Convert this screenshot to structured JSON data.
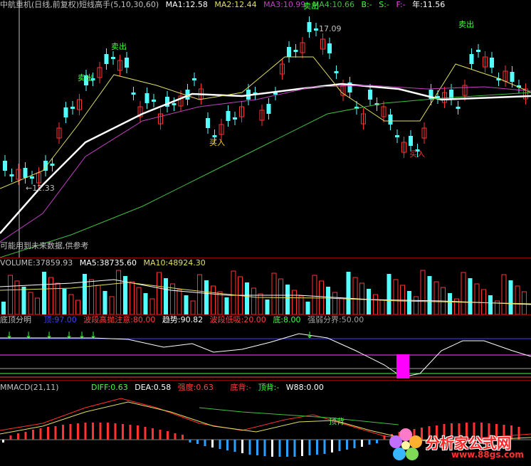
{
  "main": {
    "title": "中航重机(日线,前复权)",
    "indicator": "短线高手(5,10,30,60)",
    "ma1": "MA1:12.58",
    "ma2": "MA2:12.44",
    "ma3": "MA3:10.99",
    "ma4": "MA4:10.66",
    "b": "B:-",
    "s": "S:-",
    "f": "F:-",
    "nian": "年:11.56",
    "high_label": "17.09",
    "low_label": "12.33",
    "sell_label": "卖出",
    "buy_label": "买入",
    "disclaimer": "可能用到未来数据,供参考",
    "colors": {
      "up": "#ff3232",
      "down": "#54ffff",
      "ma_white": "#ffffff",
      "ma_yellow": "#e0e060",
      "ma_purple": "#c040c0",
      "ma_green": "#40c040"
    }
  },
  "volume": {
    "volume": "VOLUME:37859.93",
    "ma5": "MA5:38735.60",
    "ma10": "MA10:48924.30"
  },
  "dingdi": {
    "name": "底顶分明",
    "ding": "顶:97.00",
    "high_warn": "波段高抛注意:80.00",
    "trend": "趋势:90.82",
    "low_buy": "波段低吸:20.00",
    "di": "底:8.00",
    "boundary": "强弱分界:50.00"
  },
  "macd": {
    "name": "MMACD(21,11)",
    "diff": "DIFF:0.63",
    "dea": "DEA:0.58",
    "strength": "强度:0.63",
    "dibei": "底背:-",
    "dingbei": "顶背:-",
    "w88": "W88:0.00",
    "dingbei_label": "顶背"
  },
  "watermark": {
    "brand": "分析家公式网",
    "url": "www.88gs.com"
  }
}
